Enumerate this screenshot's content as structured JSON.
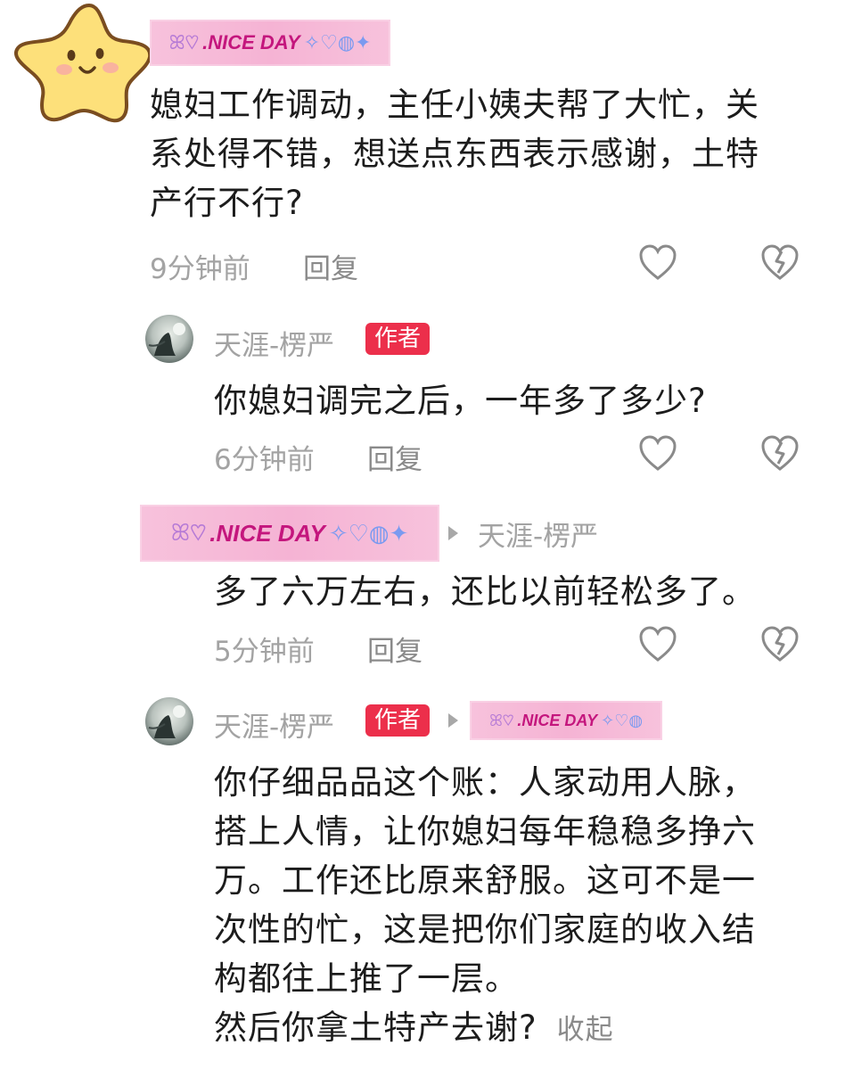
{
  "comments": [
    {
      "nickname_tag": ".NICE DAY",
      "text_lines": [
        "媳妇工作调动，主任小姨夫帮了大忙，关",
        "系处得不错，想送点东西表示感谢，土特",
        "产行不行?"
      ],
      "time": "9分钟前",
      "reply_label": "回复"
    },
    {
      "username": "天涯-楞严",
      "badge": "作者",
      "text_lines": [
        "你媳妇调完之后，一年多了多少?"
      ],
      "time": "6分钟前",
      "reply_label": "回复"
    },
    {
      "nickname_tag": ".NICE DAY",
      "reply_to": "天涯-楞严",
      "text_lines": [
        "多了六万左右，还比以前轻松多了。"
      ],
      "time": "5分钟前",
      "reply_label": "回复"
    },
    {
      "username": "天涯-楞严",
      "badge": "作者",
      "reply_to_tag": ".NICE DAY",
      "text_lines": [
        "你仔细品品这个账：人家动用人脉，",
        "搭上人情，让你媳妇每年稳稳多挣六",
        "万。工作还比原来舒服。这可不是一",
        "次性的忙，这是把你们家庭的收入结",
        "构都往上推了一层。",
        "然后你拿土特产去谢?"
      ],
      "collapse_label": "收起"
    }
  ],
  "icons": {
    "like": "heart-outline-icon",
    "dislike": "broken-heart-outline-icon"
  },
  "colors": {
    "author_badge": "#ec2f4b",
    "nickname_tag": "#f5b3d4",
    "meta_gray": "#a3a3a3"
  }
}
